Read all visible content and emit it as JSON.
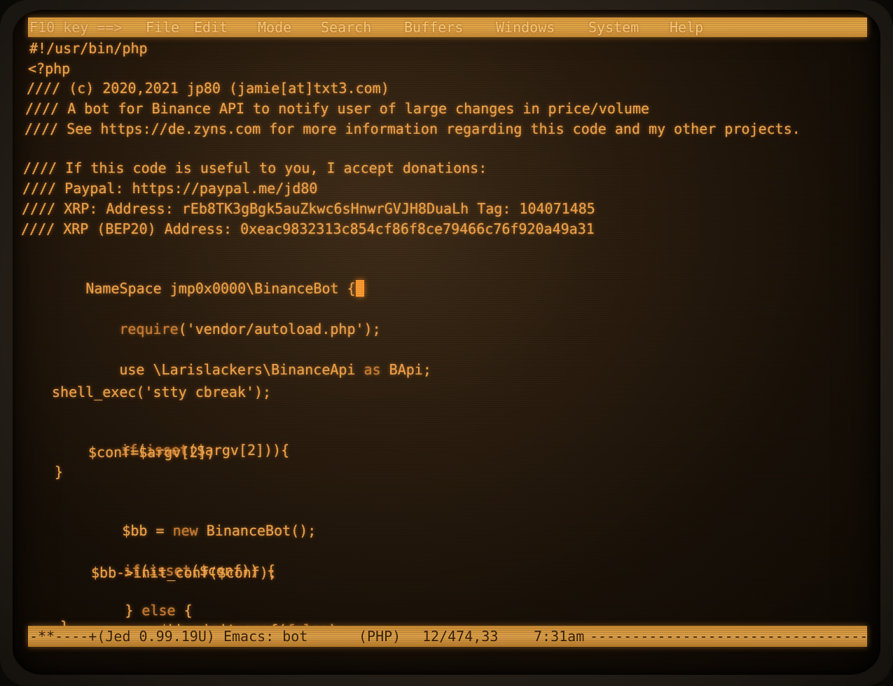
{
  "menubar": {
    "f10": "F10 key ==>",
    "items": [
      "File",
      "Edit",
      "Mode",
      "Search",
      "Buffers",
      "Windows",
      "System",
      "Help"
    ]
  },
  "code": {
    "l1": "#!/usr/bin/php",
    "l2": "<?php",
    "l3": "//// (c) 2020,2021 jp80 (jamie[at]txt3.com)",
    "l4": "//// A bot for Binance API to notify user of large changes in price/volume",
    "l5": "//// See https://de.zyns.com for more information regarding this code and my other projects.",
    "l6": "//// If this code is useful to you, I accept donations:",
    "l7": "//// Paypal: https://paypal.me/jd80",
    "l8": "//// XRP: Address: rEb8TK3gBgk5auZkwc6sHnwrGVJH8DuaLh Tag: 104071485",
    "l9": "//// XRP (BEP20) Address: 0xeac9832313c854cf86f8ce79466c76f920a49a31",
    "l10": "NameSpace jmp0x0000\\BinanceBot {",
    "l11a": "require",
    "l11b": "('vendor/autoload.php');",
    "l12a": "use \\Larislackers\\BinanceApi ",
    "l12b": "as",
    "l12c": " BApi;",
    "l13": "shell_exec('stty cbreak');",
    "l14a": "if",
    "l14b": "(",
    "l14c": "isset",
    "l14d": "($argv[2])){",
    "l15": "$conf=$argv[2];",
    "l16": "}",
    "l17a": "$bb = ",
    "l17b": "new",
    "l17c": " BinanceBot();",
    "l18a": "if",
    "l18b": "(",
    "l18c": "isset",
    "l18d": "($conf)) {",
    "l19": "$bb->init_conf($conf);",
    "l20a": "} ",
    "l20b": "else",
    "l20c": " {",
    "l21a": "$bb->init_conf(",
    "l21b": "false",
    "l21c": ");",
    "l22": "}"
  },
  "modeline": {
    "status": "-**----+(Jed 0.99.19U) Emacs: bot",
    "mode": "(PHP)",
    "position": "12/474,33",
    "time": "7:31am",
    "fill": "--------------------------------------------------"
  }
}
